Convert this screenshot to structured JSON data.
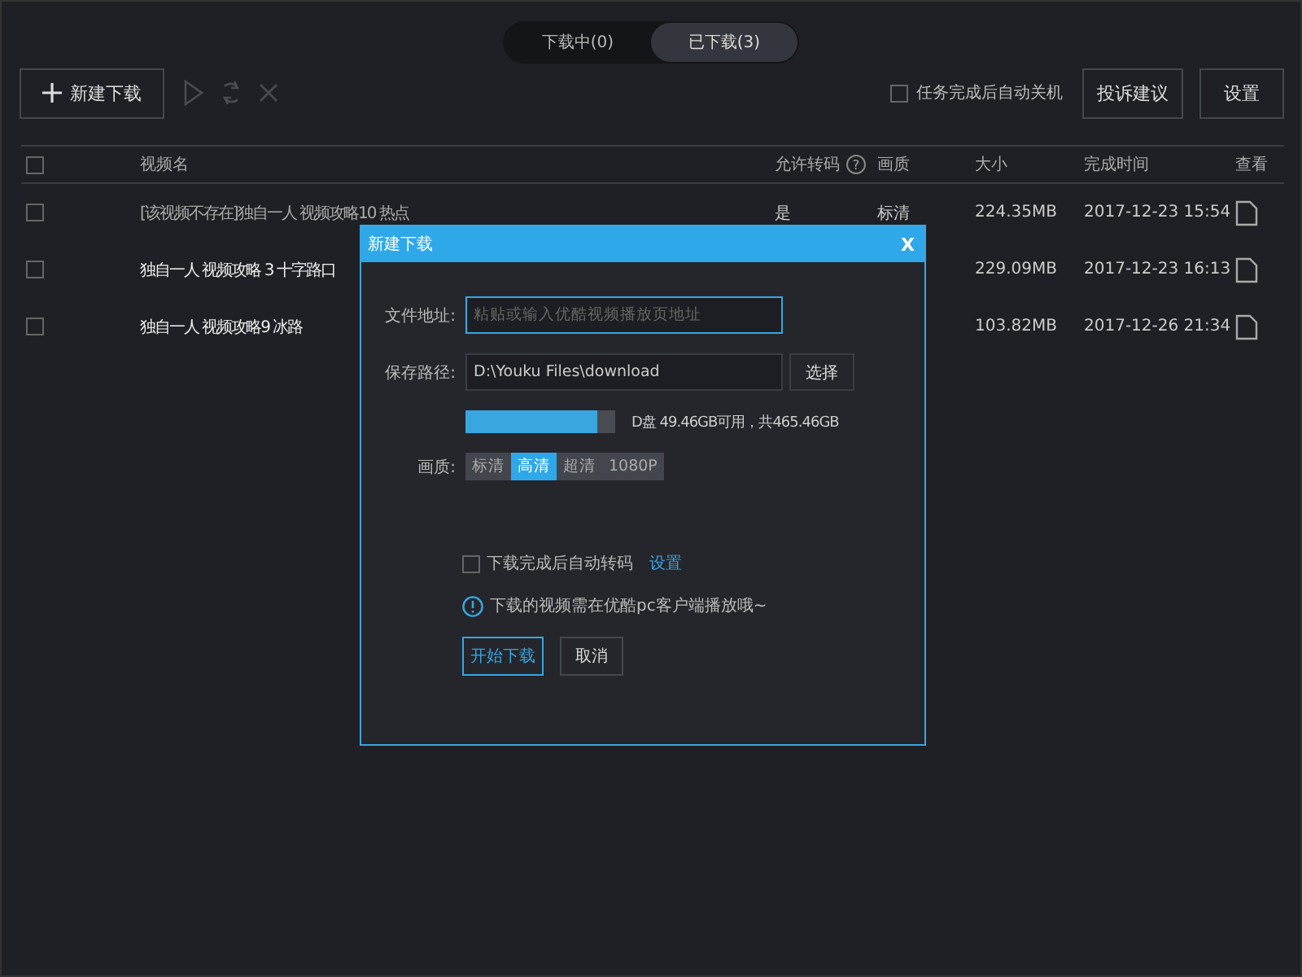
{
  "tabs": [
    {
      "label": "下载中(0)",
      "selected": false
    },
    {
      "label": "已下载(3)",
      "selected": true
    }
  ],
  "toolbar": {
    "new_download": "新建下载",
    "actions_disabled": true,
    "auto_shutdown": {
      "label": "任务完成后自动关机",
      "checked": false
    },
    "buttons": [
      "投诉建议",
      "设置"
    ]
  },
  "table": {
    "all_checked": false,
    "columns": [
      "视频名",
      "允许转码",
      "画质",
      "大小",
      "完成时间",
      "查看"
    ],
    "help": "?",
    "rows": [
      {
        "checked": false,
        "name": "[该视频不存在]独自一人 视频攻略10 热点",
        "dimmed": true,
        "transcode": "是",
        "quality": "标清",
        "size": "224.35MB",
        "time": "2017-12-23 15:54"
      },
      {
        "checked": false,
        "name": "独自一人 视频攻略 3 十字路口",
        "dimmed": false,
        "size": "229.09MB",
        "time": "2017-12-23 16:13"
      },
      {
        "checked": false,
        "name": "独自一人 视频攻略9 冰路",
        "dimmed": false,
        "size": "103.82MB",
        "time": "2017-12-26 21:34"
      }
    ]
  },
  "dialog": {
    "title": "新建下载",
    "close": "X",
    "url_label": "文件地址:",
    "url_placeholder": "粘贴或输入优酷视频播放页地址",
    "path_label": "保存路径:",
    "path_value": "D:\\Youku Files\\download",
    "choose": "选择",
    "disk": {
      "level": 0.88,
      "reading": "D盘 49.46GB可用，共465.46GB"
    },
    "quality_label": "画质:",
    "qualities": [
      {
        "label": "标清",
        "selected": false
      },
      {
        "label": "高清",
        "selected": true
      },
      {
        "label": "超清",
        "selected": false
      },
      {
        "label": "1080P",
        "selected": false
      }
    ],
    "auto_transcode": {
      "label": "下载完成后自动转码",
      "checked": false,
      "link": "设置"
    },
    "notice": "下载的视频需在优酷pc客户端播放哦~",
    "buttons": [
      {
        "label": "开始下载",
        "primary": true
      },
      {
        "label": "取消",
        "primary": false
      }
    ]
  }
}
